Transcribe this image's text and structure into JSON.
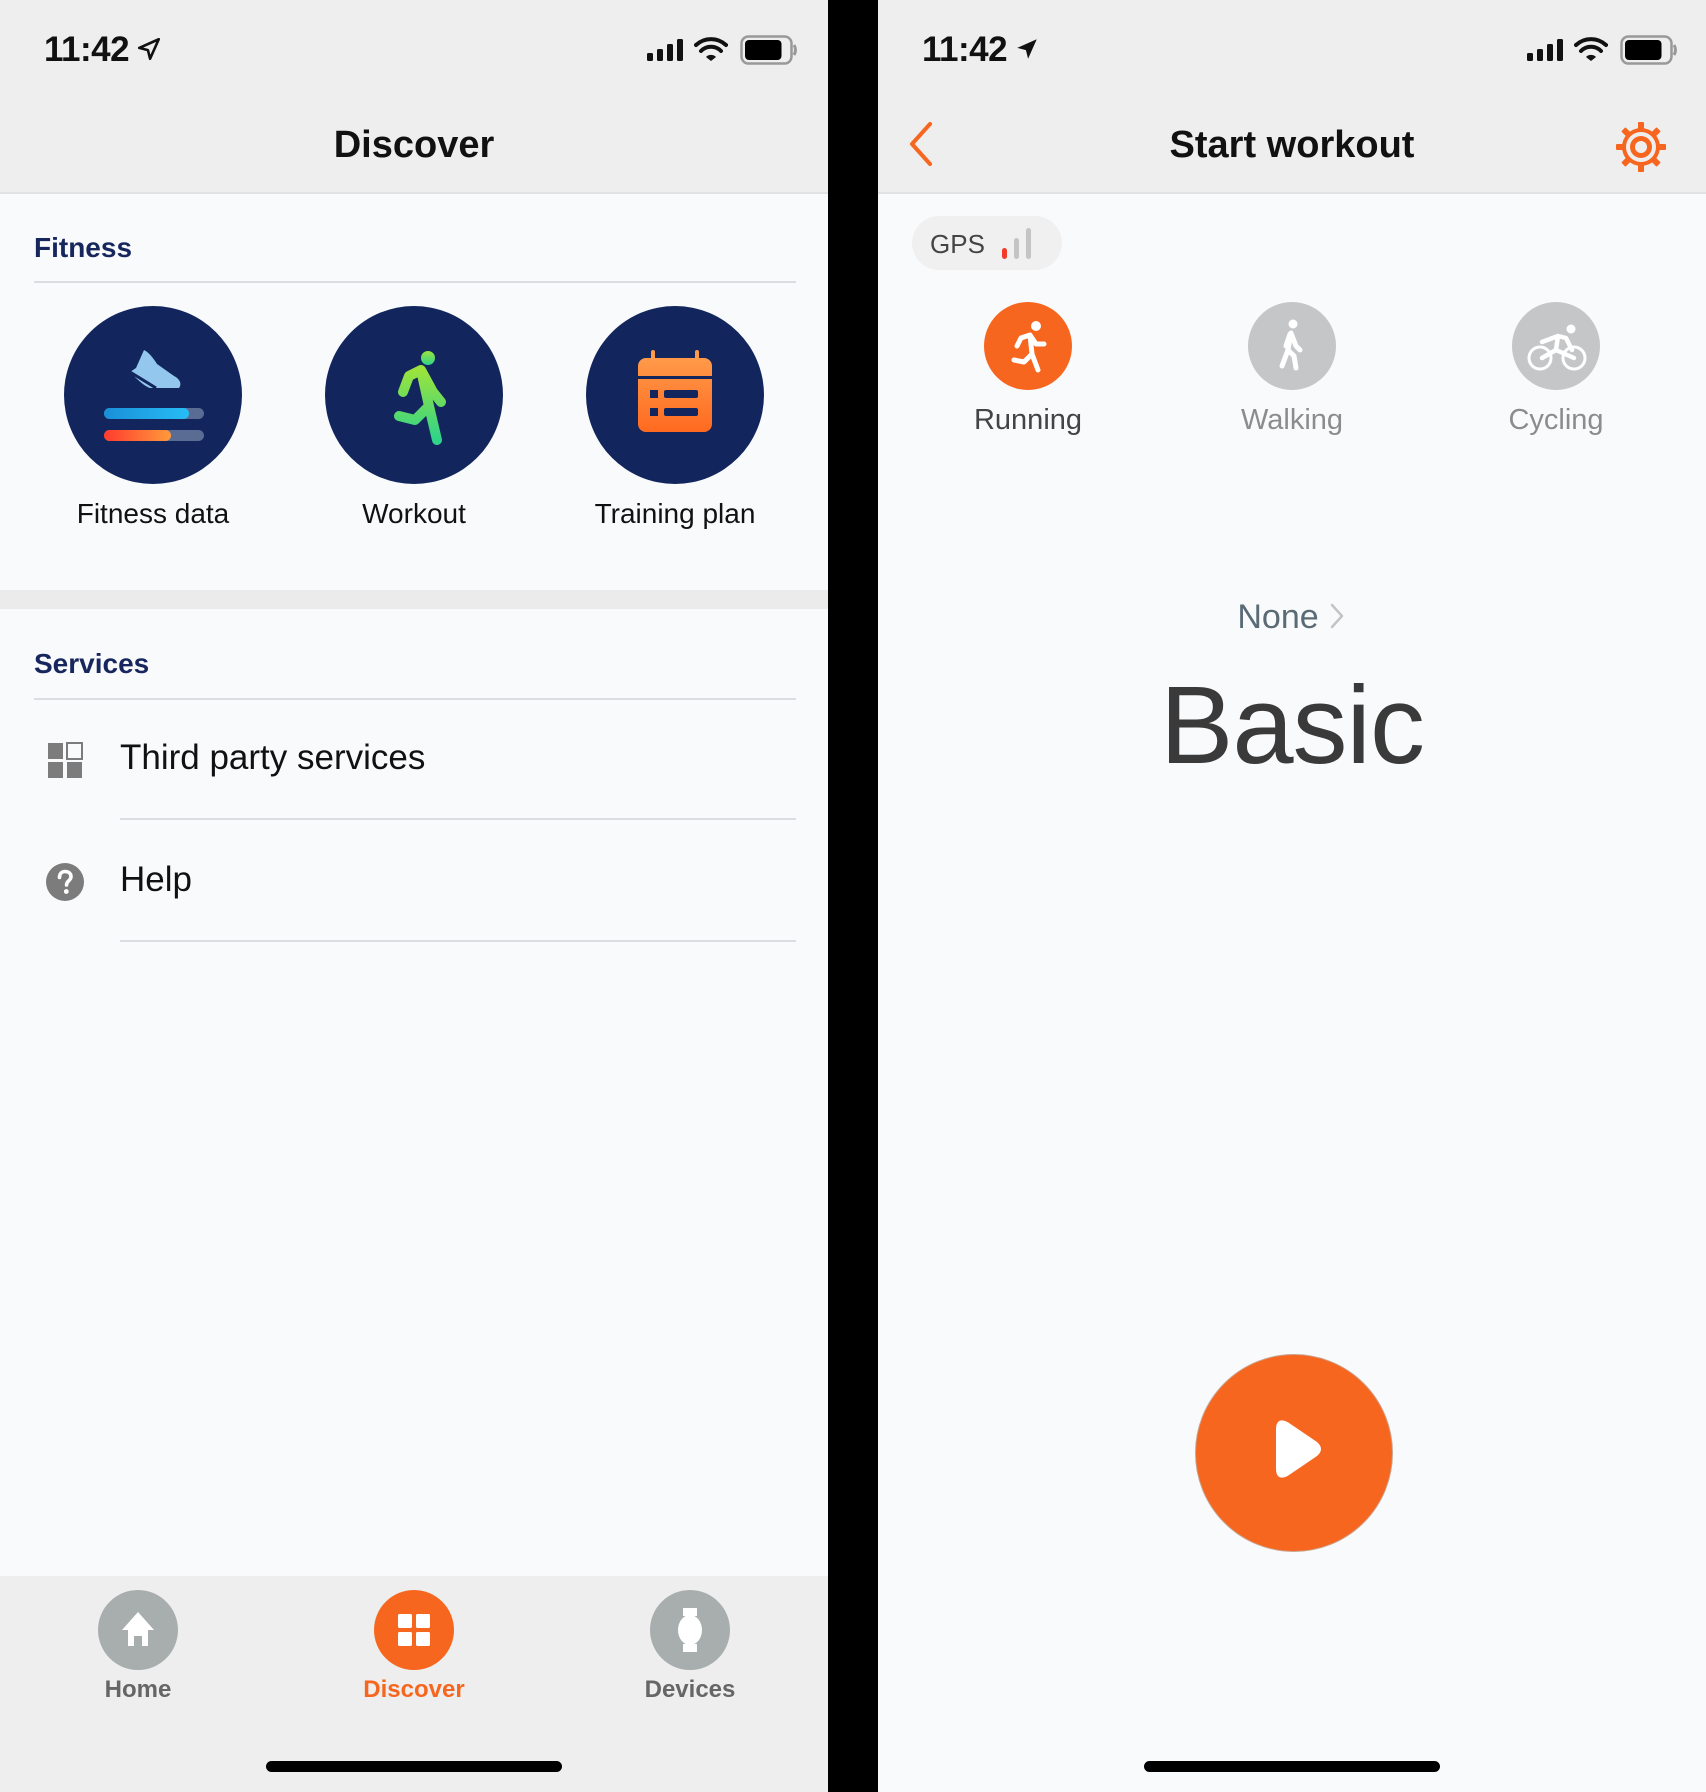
{
  "left": {
    "status_bar": {
      "time": "11:42",
      "battery_level": 0.85
    },
    "nav": {
      "title": "Discover"
    },
    "fitness": {
      "title": "Fitness",
      "tiles": [
        {
          "label": "Fitness data",
          "icon": "fitness-data-icon"
        },
        {
          "label": "Workout",
          "icon": "running-figure-icon"
        },
        {
          "label": "Training plan",
          "icon": "calendar-icon"
        }
      ]
    },
    "services": {
      "title": "Services",
      "items": [
        {
          "label": "Third party services",
          "icon": "grid-icon"
        },
        {
          "label": "Help",
          "icon": "help-icon"
        }
      ]
    },
    "tab_bar": {
      "tabs": [
        {
          "label": "Home",
          "icon": "home-icon",
          "active": false
        },
        {
          "label": "Discover",
          "icon": "grid-icon",
          "active": true
        },
        {
          "label": "Devices",
          "icon": "watch-icon",
          "active": false
        }
      ]
    }
  },
  "right": {
    "status_bar": {
      "time": "11:42",
      "battery_level": 0.85
    },
    "nav": {
      "title": "Start workout",
      "back_icon": "chevron-left-icon",
      "settings_icon": "gear-icon"
    },
    "gps": {
      "label": "GPS",
      "signal_bars": 1,
      "signal_max": 3
    },
    "sports": [
      {
        "label": "Running",
        "icon": "running-icon",
        "active": true
      },
      {
        "label": "Walking",
        "icon": "walking-icon",
        "active": false
      },
      {
        "label": "Cycling",
        "icon": "cycling-icon",
        "active": false
      }
    ],
    "plan_selector": {
      "value": "None"
    },
    "mode": {
      "name": "Basic"
    },
    "start_button": {
      "icon": "play-icon"
    }
  },
  "colors": {
    "accent": "#f7661f",
    "navy": "#12265d",
    "section_title": "#17275e",
    "inactive_gray": "#a8adad",
    "background": "#f9fafc",
    "bar_background": "#eeeeee"
  }
}
